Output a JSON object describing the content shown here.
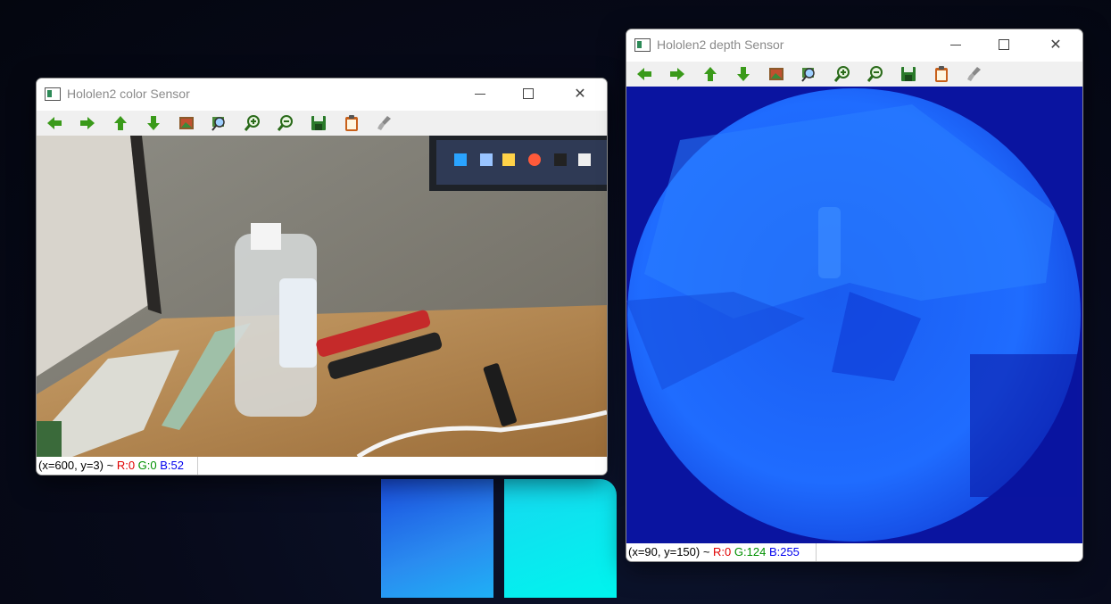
{
  "desktop": {
    "logo": "windows-logo"
  },
  "windows": [
    {
      "id": "color",
      "title": "Hololen2 color Sensor",
      "status": {
        "coords": "(x=600, y=3) ~ ",
        "r": "R:0",
        "g": "G:0",
        "b": "B:52"
      }
    },
    {
      "id": "depth",
      "title": "Hololen2 depth Sensor",
      "status": {
        "coords": "(x=90, y=150) ~ ",
        "r": "R:0",
        "g": "G:124",
        "b": "B:255"
      }
    }
  ],
  "toolbar_icons": [
    "arrow-left-icon",
    "arrow-right-icon",
    "arrow-up-icon",
    "arrow-down-icon",
    "image-icon",
    "zoom-fit-icon",
    "zoom-in-icon",
    "zoom-out-icon",
    "save-icon",
    "copy-icon",
    "clear-icon"
  ],
  "colors": {
    "arrow": "#3a9a1a",
    "depth_bg": "#0a14a0",
    "depth_fg": "#1f6cff"
  }
}
